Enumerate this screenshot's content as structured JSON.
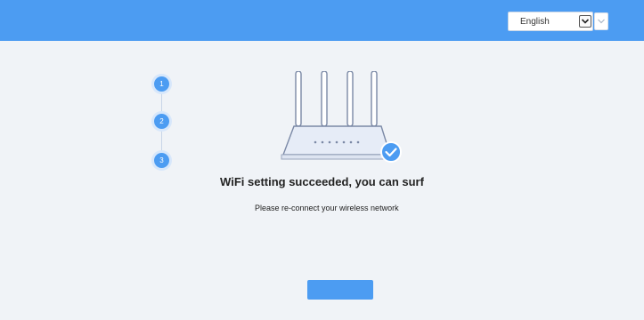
{
  "header": {
    "language": {
      "selected": "English",
      "caret_icon": "chevron-down-icon"
    }
  },
  "steps": [
    {
      "number": "1"
    },
    {
      "number": "2"
    },
    {
      "number": "3"
    }
  ],
  "router_icon": "router-with-checkmark-icon",
  "result": {
    "title": "WiFi setting succeeded, you can surf",
    "message": "Please re-connect your wireless network"
  },
  "colors": {
    "header_bg": "#4c9cf2",
    "accent": "#4c9cf2",
    "page_bg": "#f0f3f7"
  }
}
